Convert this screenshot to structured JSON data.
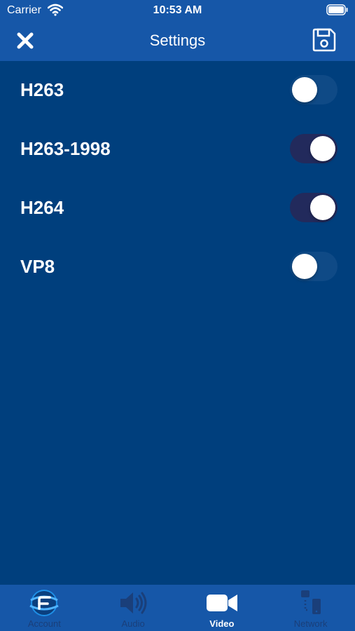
{
  "status_bar": {
    "carrier": "Carrier",
    "time": "10:53 AM"
  },
  "nav": {
    "title": "Settings"
  },
  "codecs": [
    {
      "label": "H263",
      "enabled": false
    },
    {
      "label": "H263-1998",
      "enabled": true
    },
    {
      "label": "H264",
      "enabled": true
    },
    {
      "label": "VP8",
      "enabled": false
    }
  ],
  "tabs": [
    {
      "label": "Account",
      "icon": "account-icon",
      "active": false
    },
    {
      "label": "Audio",
      "icon": "speaker-icon",
      "active": false
    },
    {
      "label": "Video",
      "icon": "video-camera-icon",
      "active": true
    },
    {
      "label": "Network",
      "icon": "network-icon",
      "active": false
    }
  ],
  "colors": {
    "background": "#003f7d",
    "bar": "#1657a8",
    "toggle_on": "#222a5c",
    "toggle_off": "#0f4a86",
    "tab_inactive": "#1a3f7a"
  }
}
